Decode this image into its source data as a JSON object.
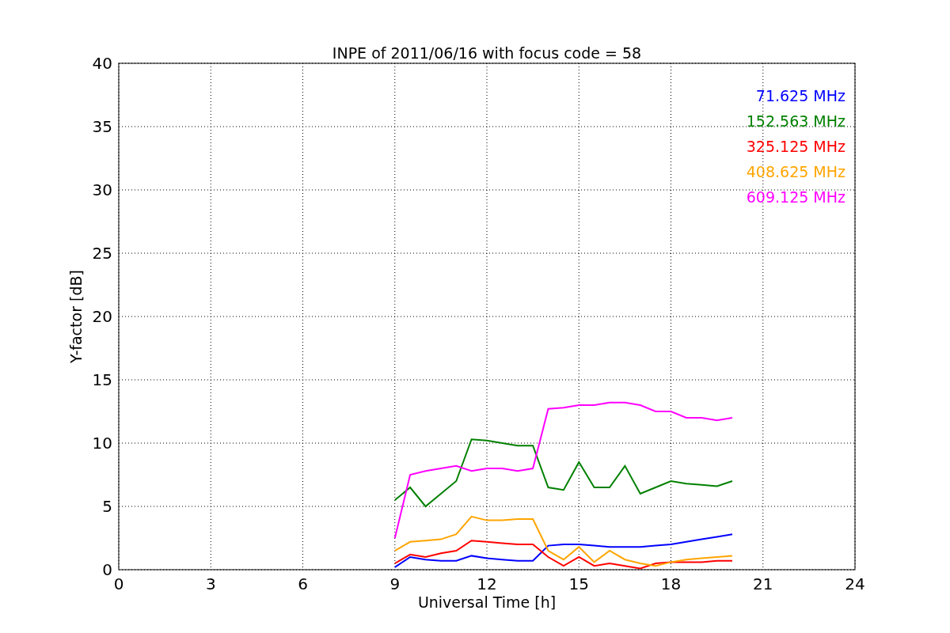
{
  "chart_data": {
    "type": "line",
    "grid": true,
    "title": "INPE of 2011/06/16 with focus code = 58",
    "xlabel": "Universal Time [h]",
    "ylabel": "Y-factor [dB]",
    "xlim": [
      0,
      24
    ],
    "ylim": [
      0,
      40
    ],
    "xticks": [
      0,
      3,
      6,
      9,
      12,
      15,
      18,
      21,
      24
    ],
    "yticks": [
      0,
      5,
      10,
      15,
      20,
      25,
      30,
      35,
      40
    ],
    "x": [
      9,
      9.5,
      10,
      10.5,
      11,
      11.5,
      12,
      12.5,
      13,
      13.5,
      14,
      14.5,
      15,
      15.5,
      16,
      16.5,
      17,
      17.5,
      18,
      18.5,
      19,
      19.5,
      20
    ],
    "series": [
      {
        "name": "71.625 MHz",
        "color": "#0000ff",
        "values": [
          0.2,
          1.0,
          0.8,
          0.7,
          0.7,
          1.1,
          0.9,
          0.8,
          0.7,
          0.7,
          1.9,
          2.0,
          2.0,
          1.9,
          1.8,
          1.8,
          1.8,
          1.9,
          2.0,
          2.2,
          2.4,
          2.6,
          2.8
        ]
      },
      {
        "name": "152.563 MHz",
        "color": "#008000",
        "values": [
          5.5,
          6.5,
          5,
          6,
          7,
          10.3,
          10.2,
          10,
          9.8,
          9.8,
          6.5,
          6.3,
          8.5,
          6.5,
          6.5,
          8.2,
          6,
          6.5,
          7,
          6.8,
          6.7,
          6.6,
          7
        ]
      },
      {
        "name": "325.125 MHz",
        "color": "#ff0000",
        "values": [
          0.5,
          1.2,
          1.0,
          1.3,
          1.5,
          2.3,
          2.2,
          2.1,
          2.0,
          2.0,
          1.0,
          0.3,
          1.0,
          0.3,
          0.5,
          0.3,
          0.1,
          0.5,
          0.6,
          0.6,
          0.6,
          0.7,
          0.7
        ]
      },
      {
        "name": "408.625 MHz",
        "color": "#ffa500",
        "values": [
          1.5,
          2.2,
          2.3,
          2.4,
          2.8,
          4.2,
          3.9,
          3.9,
          4.0,
          4.0,
          1.5,
          0.8,
          1.8,
          0.6,
          1.5,
          0.8,
          0.5,
          0.3,
          0.6,
          0.8,
          0.9,
          1.0,
          1.1
        ]
      },
      {
        "name": "609.125 MHz",
        "color": "#ff00ff",
        "values": [
          2.5,
          7.5,
          7.8,
          8,
          8.2,
          7.8,
          8,
          8,
          7.8,
          8,
          12.7,
          12.8,
          13,
          13,
          13.2,
          13.2,
          13,
          12.5,
          12.5,
          12,
          12,
          11.8,
          12
        ]
      }
    ]
  }
}
